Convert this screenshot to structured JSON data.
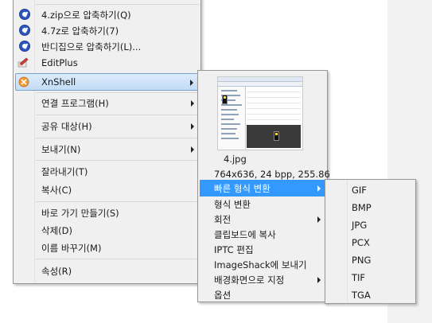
{
  "context_menu": {
    "items": [
      {
        "label": "4.zip으로 압축하기(Q)",
        "icon": "bandizip-icon"
      },
      {
        "label": "4.7z로 압축하기(7)",
        "icon": "bandizip-icon"
      },
      {
        "label": "반디집으로 압축하기(L)...",
        "icon": "bandizip-icon"
      },
      {
        "label": "EditPlus",
        "icon": "editplus-icon"
      },
      {
        "label": "XnShell",
        "icon": "xnshell-icon"
      },
      {
        "label": "연결 프로그램(H)"
      },
      {
        "label": "공유 대상(H)"
      },
      {
        "label": "보내기(N)"
      },
      {
        "label": "잘라내기(T)"
      },
      {
        "label": "복사(C)"
      },
      {
        "label": "바로 가기 만들기(S)"
      },
      {
        "label": "삭제(D)"
      },
      {
        "label": "이름 바꾸기(M)"
      },
      {
        "label": "속성(R)"
      }
    ]
  },
  "xnshell_menu": {
    "filename": "4.jpg",
    "info": "764x636, 24 bpp, 255.86",
    "items": [
      {
        "label": "빠른 형식 변환"
      },
      {
        "label": "형식 변환"
      },
      {
        "label": "회전"
      },
      {
        "label": "클립보드에 복사"
      },
      {
        "label": "IPTC 편집"
      },
      {
        "label": "ImageShack에 보내기"
      },
      {
        "label": "배경화면으로 지정"
      },
      {
        "label": "옵션"
      }
    ]
  },
  "format_menu": {
    "items": [
      "GIF",
      "BMP",
      "JPG",
      "PCX",
      "PNG",
      "TIF",
      "TGA"
    ]
  },
  "colors": {
    "menu_bg": "#f0f0f0",
    "hover_bg": "#c3dcf5",
    "selected_bg": "#3399ff"
  }
}
